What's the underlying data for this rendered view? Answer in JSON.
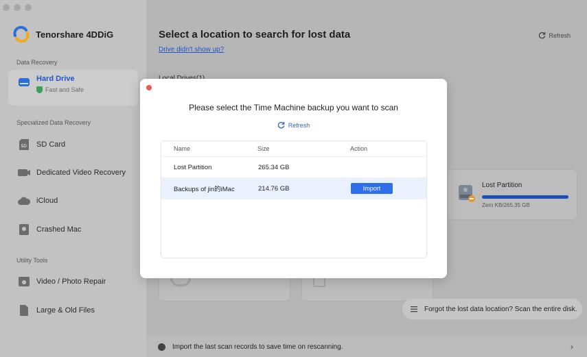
{
  "sidebar": {
    "brand": "Tenorshare 4DDiG",
    "sections": {
      "data_recovery": "Data Recovery",
      "specialized": "Specialized Data Recovery",
      "utility": "Utility Tools"
    },
    "items": {
      "hard_drive": {
        "label": "Hard Drive",
        "sub": "Fast and Safe"
      },
      "sd_card": "SD Card",
      "dedicated_video": "Dedicated Video Recovery",
      "icloud": "iCloud",
      "crashed_mac": "Crashed Mac",
      "video_photo_repair": "Video / Photo Repair",
      "large_old_files": "Large & Old Files"
    }
  },
  "main": {
    "title": "Select a location to search for lost data",
    "drive_link": "Drive didn't show up?",
    "refresh": "Refresh",
    "local_drives": "Local Drives(1)",
    "drive_card": {
      "name": "Lost Partition",
      "size": "Zero KB/265.35 GB",
      "usage_fraction": 1.0
    },
    "forgot_bar": "Forgot the lost data location? Scan the entire disk.",
    "bottom_bar": "Import the last scan records to save time on rescanning."
  },
  "modal": {
    "title": "Please select the Time Machine backup you want to scan",
    "refresh": "Refresh",
    "columns": {
      "name": "Name",
      "size": "Size",
      "action": "Action"
    },
    "rows": [
      {
        "name": "Lost Partition",
        "size": "265.34 GB",
        "action": ""
      },
      {
        "name": "Backups of jin的iMac",
        "size": "214.76 GB",
        "action": "Import"
      }
    ]
  },
  "colors": {
    "accent": "#2f6fea",
    "link": "#1e56c9",
    "close": "#ee5a52",
    "selected_row": "#eaf1fe"
  }
}
